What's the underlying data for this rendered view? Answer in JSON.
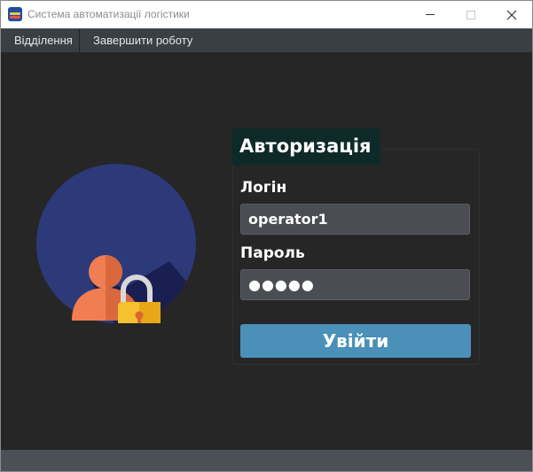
{
  "window": {
    "title": "Система автоматизації логістики",
    "icon": "app-icon"
  },
  "menu": {
    "items": [
      {
        "label": "Відділення"
      },
      {
        "label": "Завершити роботу"
      }
    ]
  },
  "auth": {
    "title": "Авторизація",
    "login_label": "Логін",
    "login_value": "operator1",
    "password_label": "Пароль",
    "password_value": "●●●●●",
    "submit_label": "Увійти"
  },
  "colors": {
    "accent": "#4a90b8",
    "title_background": "#0e2a28",
    "window_background": "#262626"
  }
}
